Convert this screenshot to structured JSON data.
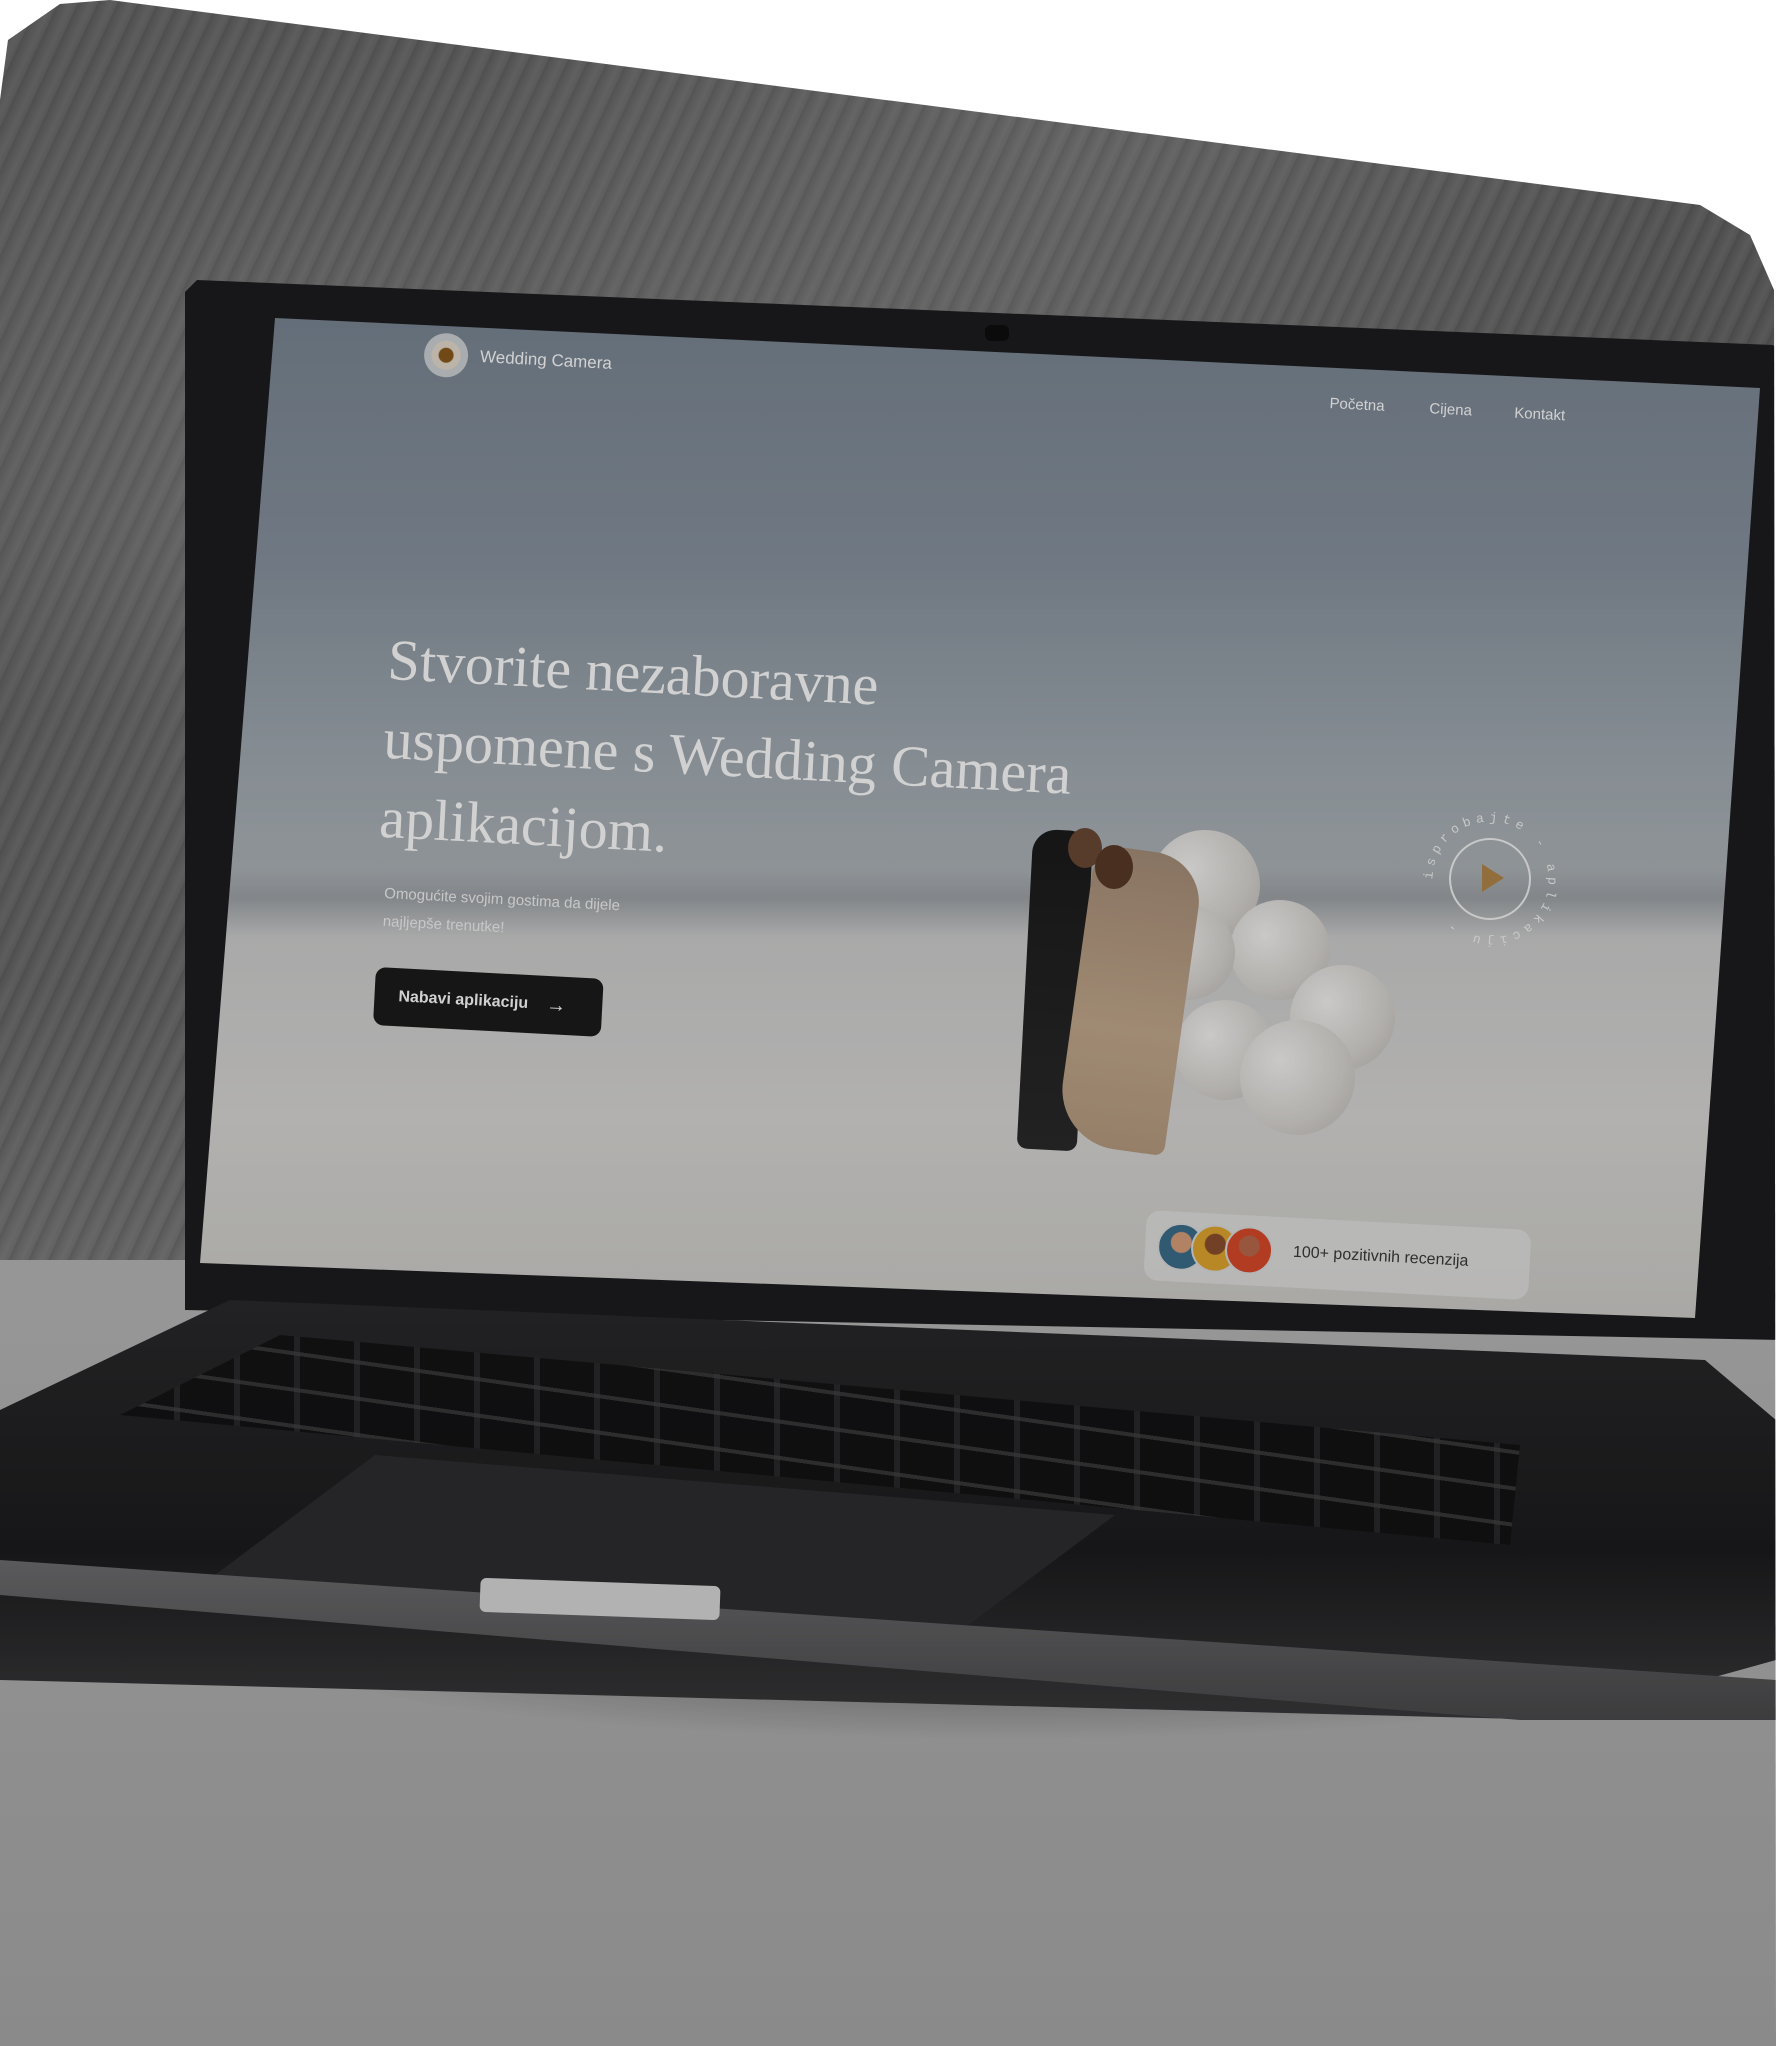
{
  "brand": {
    "name": "Wedding Camera",
    "logo_icon": "flower-logo-icon"
  },
  "nav": {
    "items": [
      "Početna",
      "Cijena",
      "Kontakt"
    ]
  },
  "hero": {
    "title_lines": [
      "Stvorite nezaboravne",
      "uspomene s Wedding Camera",
      "aplikacijom."
    ],
    "subtitle_lines": [
      "Omogućite svojim gostima da dijele",
      "najljepše trenutke!"
    ],
    "cta_label": "Nabavi aplikaciju",
    "cta_icon": "arrow-right-icon"
  },
  "play": {
    "label": "isprobajte - aplikaciju -",
    "accent": "#b2874a"
  },
  "reviews": {
    "text": "100+ pozitivnih recenzija",
    "avatars": 3
  },
  "colors": {
    "cta_bg": "#1c1c1c",
    "accent": "#b2874a"
  }
}
